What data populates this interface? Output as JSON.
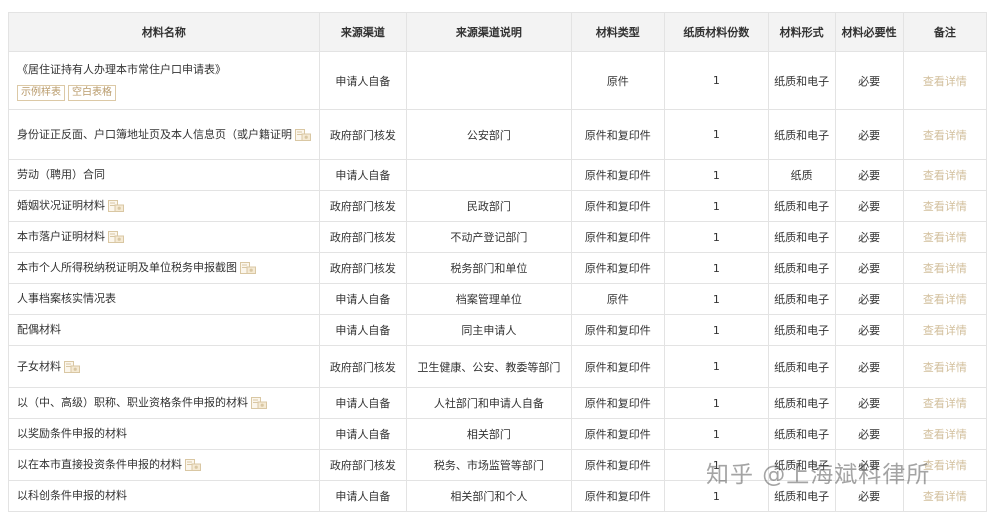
{
  "headers": [
    "材料名称",
    "来源渠道",
    "来源渠道说明",
    "材料类型",
    "纸质材料份数",
    "材料形式",
    "材料必要性",
    "备注"
  ],
  "tags": [
    "示例样表",
    "空白表格"
  ],
  "rows": [
    {
      "name": "《居住证持有人办理本市常住户口申请表》",
      "channel": "申请人自备",
      "desc": "",
      "type": "原件",
      "copies": "1",
      "form": "纸质和电子",
      "required": "必要",
      "note": "查看详情"
    },
    {
      "name": "身份证正反面、户口簿地址页及本人信息页（或户籍证明",
      "channel": "政府部门核发",
      "desc": "公安部门",
      "type": "原件和复印件",
      "copies": "1",
      "form": "纸质和电子",
      "required": "必要",
      "note": "查看详情"
    },
    {
      "name": "劳动（聘用）合同",
      "channel": "申请人自备",
      "desc": "",
      "type": "原件和复印件",
      "copies": "1",
      "form": "纸质",
      "required": "必要",
      "note": "查看详情"
    },
    {
      "name": "婚姻状况证明材料",
      "channel": "政府部门核发",
      "desc": "民政部门",
      "type": "原件和复印件",
      "copies": "1",
      "form": "纸质和电子",
      "required": "必要",
      "note": "查看详情"
    },
    {
      "name": "本市落户证明材料",
      "channel": "政府部门核发",
      "desc": "不动产登记部门",
      "type": "原件和复印件",
      "copies": "1",
      "form": "纸质和电子",
      "required": "必要",
      "note": "查看详情"
    },
    {
      "name": "本市个人所得税纳税证明及单位税务申报截图",
      "channel": "政府部门核发",
      "desc": "税务部门和单位",
      "type": "原件和复印件",
      "copies": "1",
      "form": "纸质和电子",
      "required": "必要",
      "note": "查看详情"
    },
    {
      "name": "人事档案核实情况表",
      "channel": "申请人自备",
      "desc": "档案管理单位",
      "type": "原件",
      "copies": "1",
      "form": "纸质和电子",
      "required": "必要",
      "note": "查看详情"
    },
    {
      "name": "配偶材料",
      "channel": "申请人自备",
      "desc": "同主申请人",
      "type": "原件和复印件",
      "copies": "1",
      "form": "纸质和电子",
      "required": "必要",
      "note": "查看详情"
    },
    {
      "name": "子女材料",
      "channel": "政府部门核发",
      "desc": "卫生健康、公安、教委等部门",
      "type": "原件和复印件",
      "copies": "1",
      "form": "纸质和电子",
      "required": "必要",
      "note": "查看详情"
    },
    {
      "name": "以（中、高级）职称、职业资格条件申报的材料",
      "channel": "申请人自备",
      "desc": "人社部门和申请人自备",
      "type": "原件和复印件",
      "copies": "1",
      "form": "纸质和电子",
      "required": "必要",
      "note": "查看详情"
    },
    {
      "name": "以奖励条件申报的材料",
      "channel": "申请人自备",
      "desc": "相关部门",
      "type": "原件和复印件",
      "copies": "1",
      "form": "纸质和电子",
      "required": "必要",
      "note": "查看详情"
    },
    {
      "name": "以在本市直接投资条件申报的材料",
      "channel": "政府部门核发",
      "desc": "税务、市场监管等部门",
      "type": "原件和复印件",
      "copies": "1",
      "form": "纸质和电子",
      "required": "必要",
      "note": "查看详情"
    },
    {
      "name": "以科创条件申报的材料",
      "channel": "申请人自备",
      "desc": "相关部门和个人",
      "type": "原件和复印件",
      "copies": "1",
      "form": "纸质和电子",
      "required": "必要",
      "note": "查看详情"
    }
  ],
  "watermark": "知乎 @上海斌科律所"
}
